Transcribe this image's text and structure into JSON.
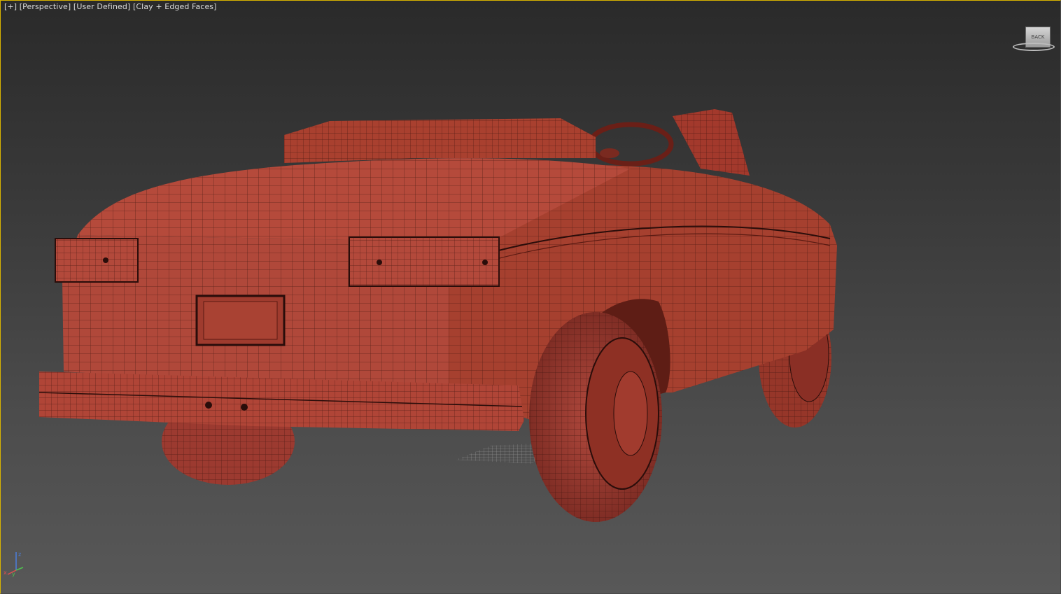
{
  "viewport": {
    "label_parts": [
      "[+]",
      "[Perspective]",
      "[User Defined]",
      "[Clay + Edged Faces]"
    ],
    "active_border_color": "#d9b400"
  },
  "viewcube": {
    "face_label": "BACK",
    "icon": "viewcube-icon"
  },
  "axis_tripod": {
    "x_label": "x",
    "y_label": "y",
    "z_label": "z",
    "icon": "axis-tripod-icon"
  },
  "scene": {
    "object": "car-model",
    "shading": "clay-edged-faces",
    "clay_color": "#b04a3e",
    "edge_color": "#2a0d0a"
  }
}
